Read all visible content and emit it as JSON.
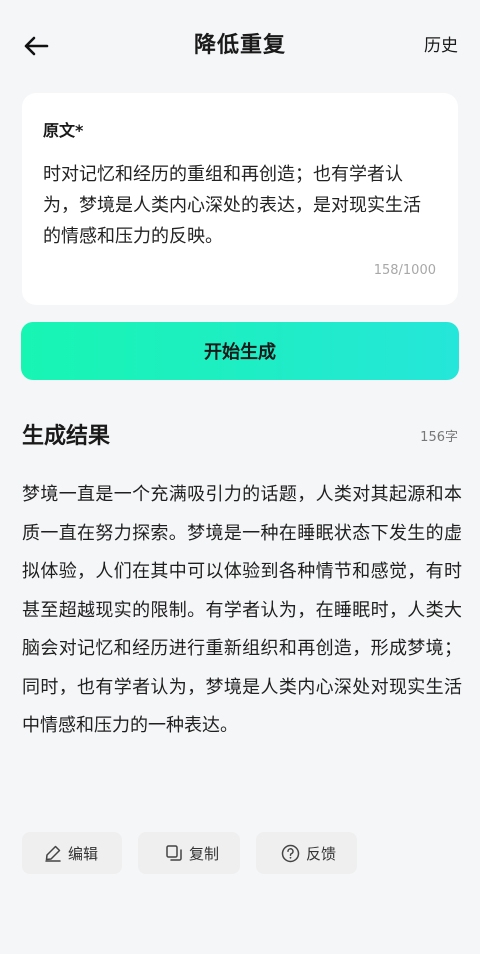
{
  "header": {
    "title": "降低重复",
    "history_label": "历史"
  },
  "source": {
    "label": "原文*",
    "text": "时对记忆和经历的重组和再创造；也有学者认为，梦境是人类内心深处的表达，是对现实生活的情感和压力的反映。",
    "counter": "158/1000"
  },
  "generate_button": {
    "label": "开始生成"
  },
  "result": {
    "title": "生成结果",
    "count": "156字",
    "text": "梦境一直是一个充满吸引力的话题，人类对其起源和本质一直在努力探索。梦境是一种在睡眠状态下发生的虚拟体验，人们在其中可以体验到各种情节和感觉，有时甚至超越现实的限制。有学者认为，在睡眠时，人类大脑会对记忆和经历进行重新组织和再创造，形成梦境；同时，也有学者认为，梦境是人类内心深处对现实生活中情感和压力的一种表达。"
  },
  "actions": {
    "edit_label": "编辑",
    "copy_label": "复制",
    "feedback_label": "反馈"
  },
  "icons": {
    "back": "arrow-left-icon",
    "edit": "pencil-icon",
    "copy": "copy-icon",
    "feedback": "question-circle-icon"
  },
  "colors": {
    "background": "#f5f6f8",
    "card": "#ffffff",
    "button_gradient_start": "#17f5b3",
    "button_gradient_end": "#25e6da",
    "action_bg": "#efefef"
  }
}
